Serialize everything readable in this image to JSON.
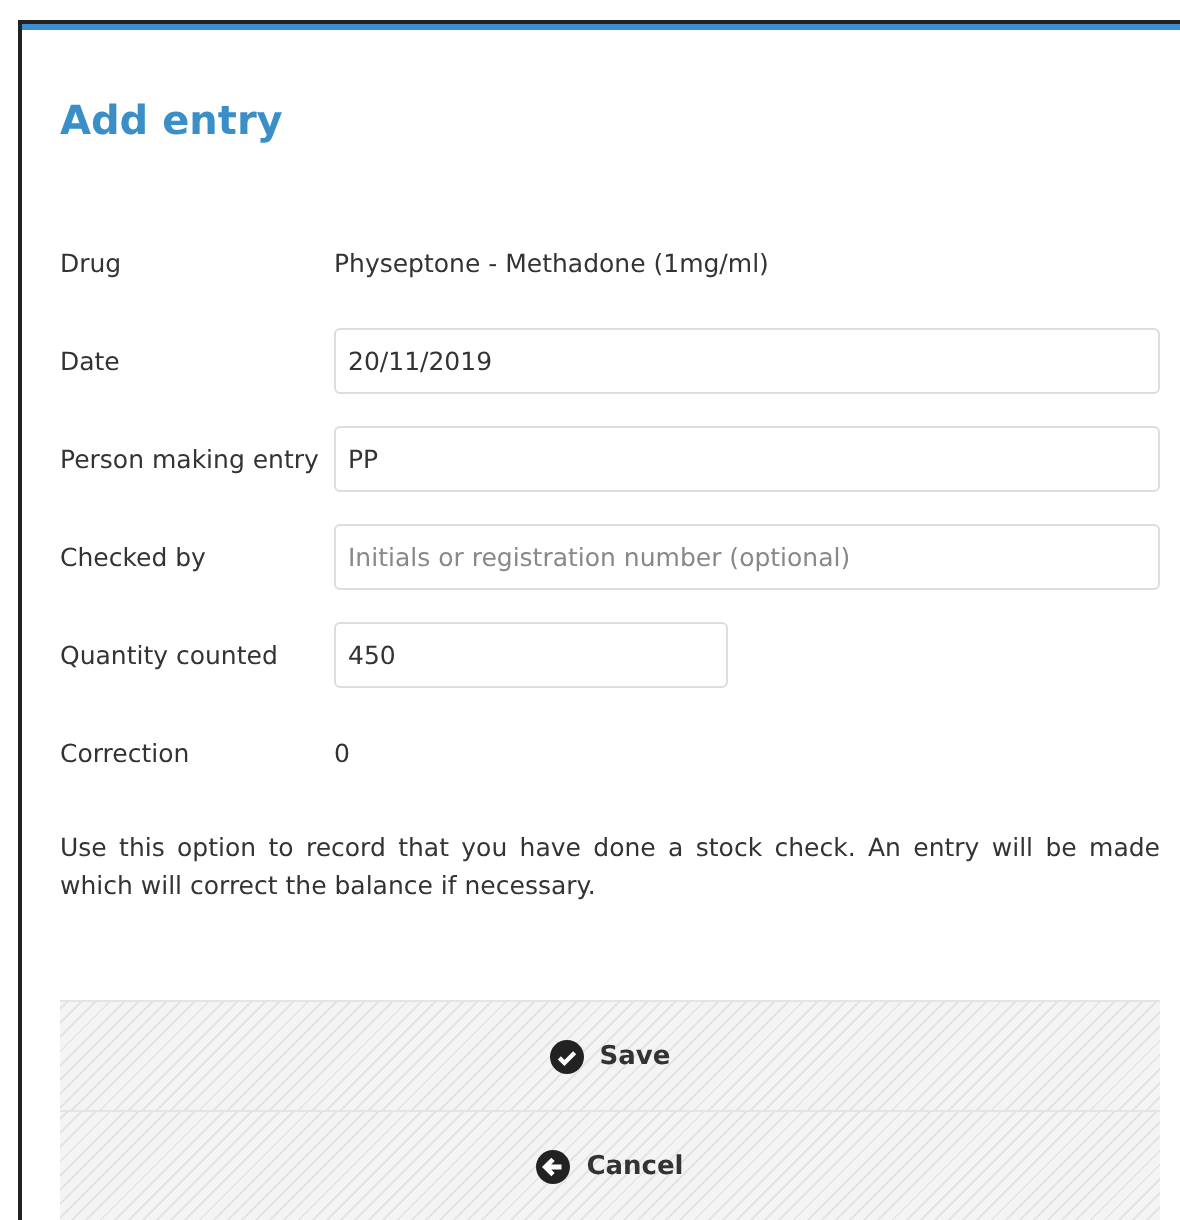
{
  "title": "Add entry",
  "fields": [
    {
      "label": "Drug",
      "kind": "text",
      "value": "Physeptone - Methadone (1mg/ml)"
    },
    {
      "label": "Date",
      "kind": "input",
      "value": "20/11/2019"
    },
    {
      "label": "Person making entry",
      "kind": "input",
      "value": "PP"
    },
    {
      "label": "Checked by",
      "kind": "input",
      "placeholder": "Initials or registration number (optional)"
    },
    {
      "label": "Quantity counted",
      "kind": "short-input",
      "value": "450"
    },
    {
      "label": "Correction",
      "kind": "text",
      "value": "0"
    }
  ],
  "help": "Use this option to record that you have done a stock check. An entry will be made which will correct the balance if necessary.",
  "buttons": [
    {
      "label": "Save",
      "kind": "save"
    },
    {
      "label": "Cancel",
      "kind": "cancel"
    }
  ]
}
